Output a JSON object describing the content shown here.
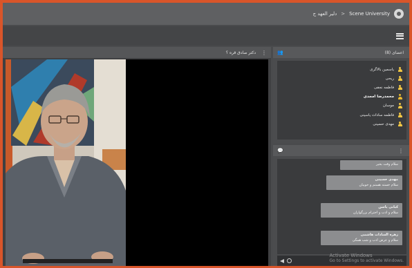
{
  "title_bar": {
    "meeting_name": "دلیر العهد ج",
    "separator": ">",
    "org_name": "Scene University"
  },
  "video_pod": {
    "title": "دکتر صادق قره ؟",
    "menu_icon": "vertical-dots-icon"
  },
  "attendees_pod": {
    "title": "اعضای (8)",
    "attendees": [
      {
        "name": "یاسمین بالاگری",
        "bold": false
      },
      {
        "name": "ریحی",
        "bold": false
      },
      {
        "name": "فاطمه نجفی",
        "bold": false
      },
      {
        "name": "محمدرضا امجدی",
        "bold": true
      },
      {
        "name": "موسان",
        "bold": false
      },
      {
        "name": "فاطمه سادات یاسینی",
        "bold": false
      },
      {
        "name": "مهدی حسینی",
        "bold": false
      }
    ]
  },
  "chat_pod": {
    "messages": [
      {
        "sender": "",
        "text": "سلام وقت بخیر"
      },
      {
        "sender": "مهدی حسینی",
        "text": "سلام خسته هستم و خوبیان"
      },
      {
        "sender": "کیانی یاسن",
        "text": "سلام و ادب و احترام بزرگواران"
      },
      {
        "sender": "زهره السادات هاشمی",
        "text": "سلام و عرض ادب و شب همگی"
      }
    ],
    "input_placeholder": "",
    "watermark_line1": "Activate Windows",
    "watermark_line2": "Go to Settings to activate Windows."
  },
  "colors": {
    "frame": "#d9552a",
    "attendee_icon": "#f2c744"
  }
}
